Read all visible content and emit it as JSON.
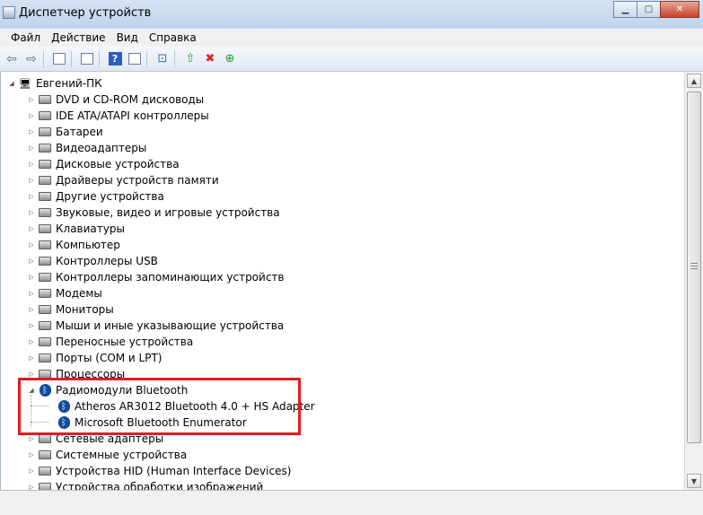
{
  "window": {
    "title": "Диспетчер устройств",
    "controls": [
      "minimize",
      "maximize",
      "close"
    ]
  },
  "menubar": {
    "items": [
      "Файл",
      "Действие",
      "Вид",
      "Справка"
    ]
  },
  "toolbar": {
    "buttons": [
      "back-icon",
      "forward-icon",
      "console-tree-icon",
      "properties-icon",
      "help-icon",
      "action-pane-icon",
      "scan-hardware-icon",
      "update-driver-icon",
      "uninstall-icon",
      "enable-icon"
    ]
  },
  "tree": {
    "root": "Евгений-ПК",
    "categories": [
      {
        "label": "DVD и CD-ROM дисководы",
        "icon": "dvd-drive-icon"
      },
      {
        "label": "IDE ATA/ATAPI контроллеры",
        "icon": "ide-controller-icon"
      },
      {
        "label": "Батареи",
        "icon": "battery-icon"
      },
      {
        "label": "Видеоадаптеры",
        "icon": "display-adapter-icon"
      },
      {
        "label": "Дисковые устройства",
        "icon": "disk-drive-icon"
      },
      {
        "label": "Драйверы устройств памяти",
        "icon": "memory-driver-icon"
      },
      {
        "label": "Другие устройства",
        "icon": "other-devices-icon"
      },
      {
        "label": "Звуковые, видео и игровые устройства",
        "icon": "speaker-icon"
      },
      {
        "label": "Клавиатуры",
        "icon": "keyboard-icon"
      },
      {
        "label": "Компьютер",
        "icon": "computer-icon"
      },
      {
        "label": "Контроллеры USB",
        "icon": "usb-icon"
      },
      {
        "label": "Контроллеры запоминающих устройств",
        "icon": "storage-controller-icon"
      },
      {
        "label": "Модемы",
        "icon": "modem-icon"
      },
      {
        "label": "Мониторы",
        "icon": "monitor-icon"
      },
      {
        "label": "Мыши и иные указывающие устройства",
        "icon": "mouse-icon"
      },
      {
        "label": "Переносные устройства",
        "icon": "portable-device-icon"
      },
      {
        "label": "Порты (COM и LPT)",
        "icon": "port-icon"
      },
      {
        "label": "Процессоры",
        "icon": "processor-icon"
      },
      {
        "label": "Радиомодули Bluetooth",
        "icon": "bluetooth-icon",
        "expanded": true
      },
      {
        "label": "Сетевые адаптеры",
        "icon": "network-adapter-icon"
      },
      {
        "label": "Системные устройства",
        "icon": "system-devices-icon"
      },
      {
        "label": "Устройства HID (Human Interface Devices)",
        "icon": "hid-icon"
      },
      {
        "label": "Устройства обработки изображений",
        "icon": "imaging-device-icon"
      }
    ],
    "bluetooth_children": [
      {
        "label": "Atheros AR3012 Bluetooth 4.0 + HS Adapter",
        "icon": "bluetooth-icon"
      },
      {
        "label": "Microsoft Bluetooth Enumerator",
        "icon": "bluetooth-icon"
      }
    ]
  },
  "colors": {
    "highlight_border": "#e41b23",
    "bluetooth_icon": "#0d4a9c"
  }
}
